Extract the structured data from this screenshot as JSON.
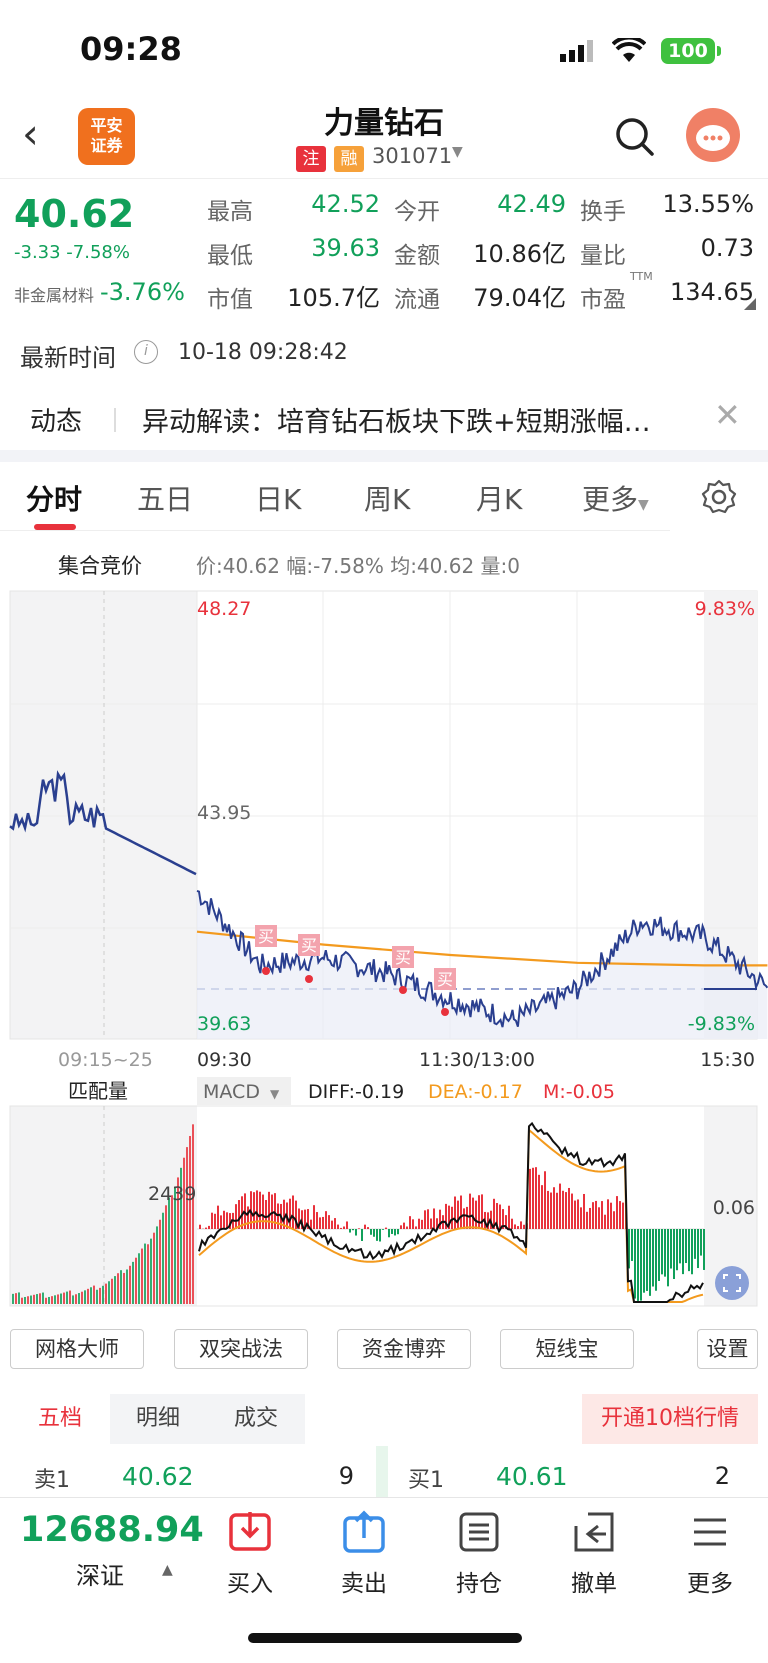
{
  "status_bar": {
    "time": "09:28",
    "battery": "100"
  },
  "header": {
    "broker_logo_line1": "平安",
    "broker_logo_line2": "证券",
    "stock_name": "力量钻石",
    "tag_zhu": "注",
    "tag_rong": "融",
    "stock_code": "301071"
  },
  "quote": {
    "price": "40.62",
    "change": "-3.33 -7.58%",
    "sector_name": "非金属材料",
    "sector_change": "-3.76%",
    "stats": [
      {
        "label": "最高",
        "value": "42.52",
        "color": "green"
      },
      {
        "label": "今开",
        "value": "42.49",
        "color": "green"
      },
      {
        "label": "换手",
        "value": "13.55%",
        "color": "dark"
      },
      {
        "label": "最低",
        "value": "39.63",
        "color": "green"
      },
      {
        "label": "金额",
        "value": "10.86亿",
        "color": "dark"
      },
      {
        "label": "量比",
        "value": "0.73",
        "color": "dark"
      },
      {
        "label": "市值",
        "value": "105.7亿",
        "color": "dark"
      },
      {
        "label": "流通",
        "value": "79.04亿",
        "color": "dark"
      },
      {
        "label": "市盈",
        "value": "134.65",
        "color": "dark"
      }
    ],
    "ttm": "TTM",
    "latest_time_label": "最新时间",
    "latest_time": "10-18 09:28:42"
  },
  "news": {
    "label": "动态",
    "text": "异动解读：培育钻石板块下跌+短期涨幅…"
  },
  "tabs": [
    "分时",
    "五日",
    "日K",
    "周K",
    "月K",
    "更多"
  ],
  "auction": {
    "label": "集合竞价",
    "info": "价:40.62  幅:-7.58%  均:40.62  量:0"
  },
  "chart": {
    "price_high": "48.27",
    "price_mid": "43.95",
    "price_low": "39.63",
    "pct_high": "9.83%",
    "pct_low": "-9.83%",
    "time_auction": "09:15~25",
    "time_open": "09:30",
    "time_mid": "11:30/13:00",
    "time_close": "15:30",
    "buy_marker": "买",
    "match_volume_label": "匹配量",
    "match_volume_value": "2439",
    "indicator": "MACD",
    "diff": "DIFF:-0.19",
    "dea": "DEA:-0.17",
    "m": "M:-0.05",
    "macd_level": "0.06",
    "colors": {
      "up": "#e8323c",
      "down": "#11a05a",
      "price_line": "#2a3f8f",
      "avg_line": "#f39a1e"
    }
  },
  "chart_data": {
    "type": "line",
    "series": [
      {
        "name": "价",
        "x": [
          "09:30",
          "10:00",
          "10:30",
          "11:00",
          "11:30",
          "13:30",
          "14:00",
          "14:30",
          "15:00",
          "15:30"
        ],
        "values": [
          42.49,
          41.05,
          41.2,
          40.9,
          40.4,
          40.0,
          40.6,
          41.9,
          41.6,
          40.62
        ]
      },
      {
        "name": "均",
        "x": [
          "09:30",
          "10:30",
          "11:30",
          "14:00",
          "15:00",
          "15:30"
        ],
        "values": [
          41.7,
          41.45,
          41.25,
          41.1,
          41.05,
          41.05
        ]
      }
    ],
    "ylim": [
      39.63,
      48.27
    ]
  },
  "indicator_buttons": [
    "网格大师",
    "双突战法",
    "资金博弈",
    "短线宝",
    "设置"
  ],
  "order_book": {
    "tabs": [
      "五档",
      "明细",
      "成交"
    ],
    "open_level10": "开通10档行情",
    "sell1_label": "卖1",
    "sell1_price": "40.62",
    "sell1_volume": "9",
    "buy1_label": "买1",
    "buy1_price": "40.61",
    "buy1_volume": "2"
  },
  "bottom_bar": {
    "index_value": "12688.94",
    "index_name": "深证",
    "buttons": [
      "买入",
      "卖出",
      "持仓",
      "撤单",
      "更多"
    ]
  }
}
